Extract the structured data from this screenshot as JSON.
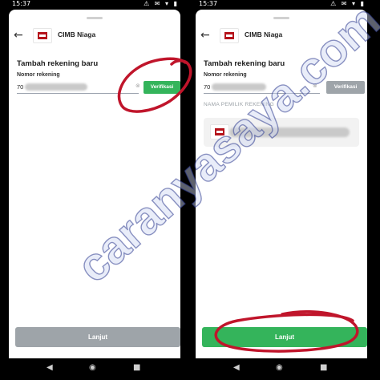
{
  "statusbar": {
    "time": "15:37",
    "icons": "⚠ ✉ ▾ ▮"
  },
  "colors": {
    "green": "#34b45b",
    "gray_disabled": "#9ea4a9",
    "brand_red": "#b5131b",
    "annotation": "#c0152b"
  },
  "left": {
    "bank_name": "CIMB Niaga",
    "section_title": "Tambah rekening baru",
    "field_label": "Nomor rekening",
    "account_prefix": "70",
    "verify_label": "Verifikasi",
    "next_label": "Lanjut"
  },
  "right": {
    "bank_name": "CIMB Niaga",
    "section_title": "Tambah rekening baru",
    "field_label": "Nomor rekening",
    "account_prefix": "70",
    "verify_label": "Verifikasi",
    "owner_label": "NAMA PEMILIK REKENING",
    "next_label": "Lanjut"
  },
  "navbar": {
    "back_glyph": "◀",
    "home_glyph": "◉",
    "recent_glyph": "■"
  },
  "watermark": {
    "text": "caranyasaya.com"
  }
}
